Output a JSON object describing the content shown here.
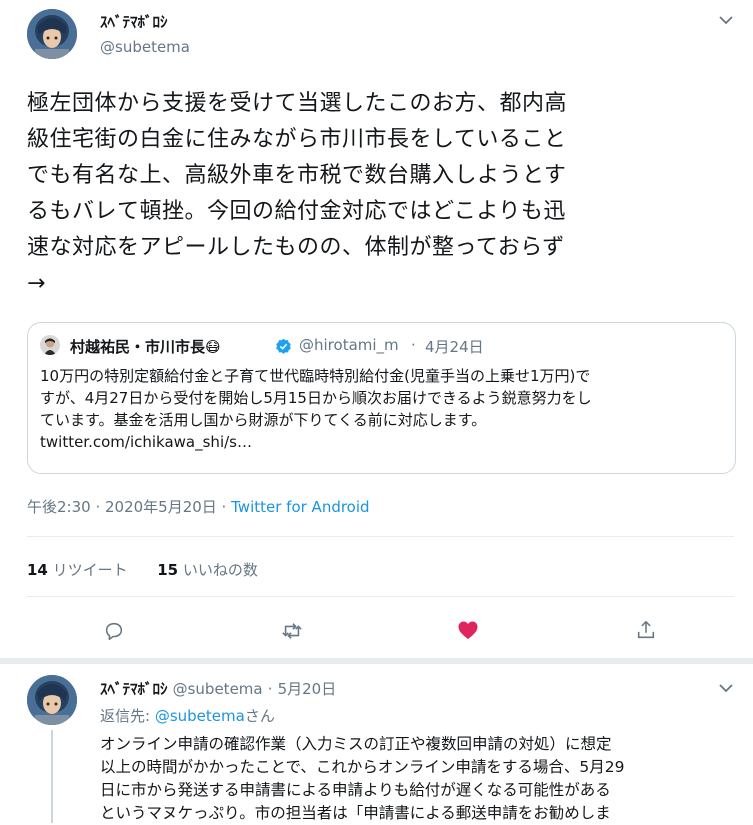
{
  "main_tweet": {
    "display_name": "ｽﾍﾞﾃﾏﾎﾞﾛｼ",
    "handle": "@subetema",
    "text_lines": [
      "極左団体から支援を受けて当選したこのお方、都内高",
      "級住宅街の白金に住みながら市川市長をしていること",
      "でも有名な上、高級外車を市税で数台購入しようとす",
      "るもバレて頓挫。今回の給付金対応ではどこよりも迅",
      "速な対応をアピールしたものの、体制が整っておらず",
      "→"
    ],
    "quote": {
      "name": "村越祐民・市川市長😷",
      "handle": "@hirotami_m",
      "separator": "·",
      "date": "4月24日",
      "text_lines": [
        "10万円の特別定額給付金と子育て世代臨時特別給付金(児童手当の上乗せ1万円)で",
        "すが、4月27日から受付を開始し5月15日から順次お届けできるよう鋭意努力をし",
        "ています。基金を活用し国から財源が下りてくる前に対応します。",
        "twitter.com/ichikawa_shi/s…"
      ]
    },
    "time": "午後2:30 · 2020年5月20日 ·",
    "source": "Twitter for Android",
    "retweets_count": "14",
    "retweets_label": "リツイート",
    "likes_count": "15",
    "likes_label": "いいねの数"
  },
  "reply_tweet": {
    "display_name": "ｽﾍﾞﾃﾏﾎﾞﾛｼ",
    "handle": "@subetema",
    "separator": "·",
    "date": "5月20日",
    "reply_to_label": "返信先:",
    "reply_to_handle": "@subetema",
    "reply_to_suffix": "さん",
    "text_lines": [
      "オンライン申請の確認作業（入力ミスの訂正や複数回申請の対処）に想定",
      "以上の時間がかかったことで、これからオンライン申請をする場合、5月29",
      "日に市から発送する申請書による申請よりも給付が遅くなる可能性がある",
      "というマヌケっぷり。市の担当者は「申請書による郵送申請をお勧めしま"
    ]
  },
  "colors": {
    "accent": "#1b95e0",
    "like": "#e0245e",
    "secondary_text": "#657786",
    "border": "#e6ecf0"
  }
}
